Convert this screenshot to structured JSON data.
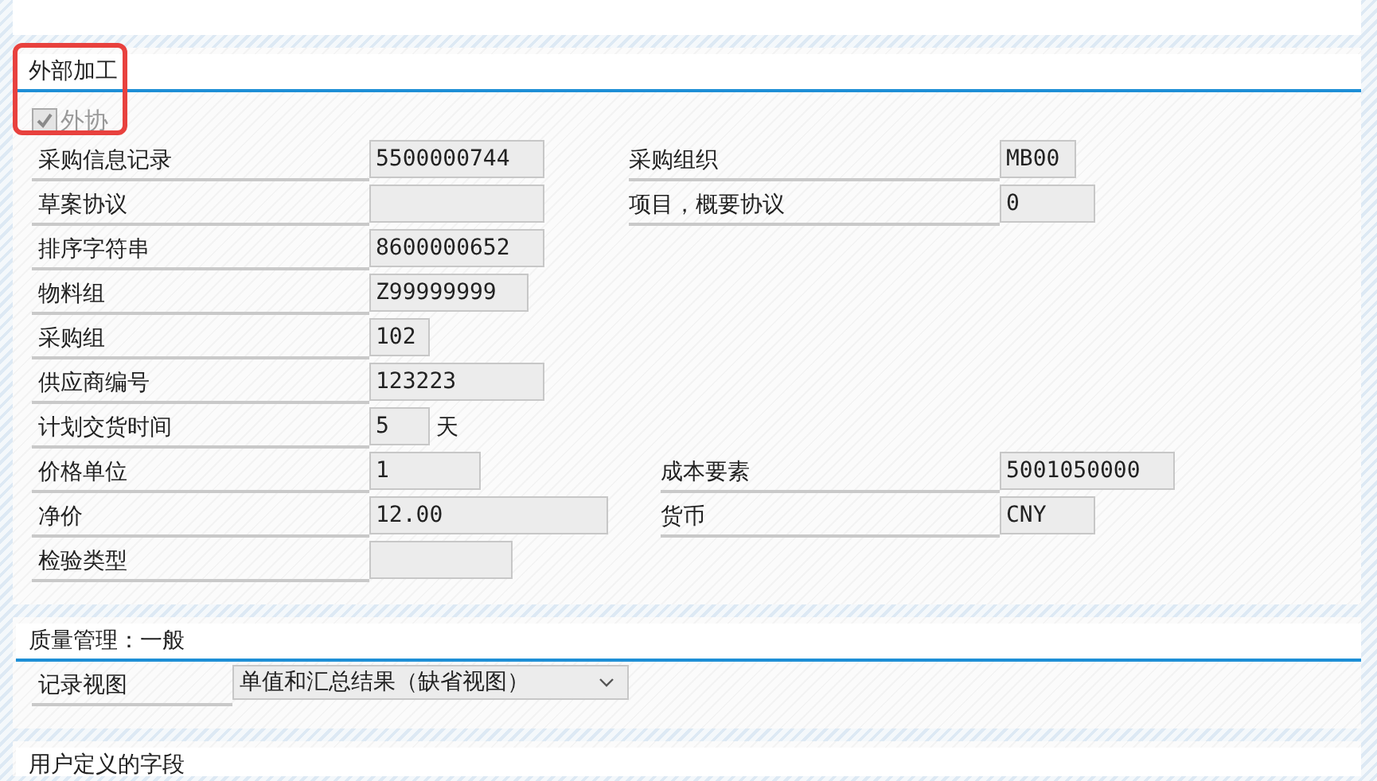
{
  "sections": [
    {
      "title": "外部加工",
      "checkbox": {
        "label": "外协",
        "checked": true,
        "disabled": true
      },
      "highlighted": true,
      "rows": [
        {
          "left": {
            "label": "采购信息记录",
            "value": "5500000744"
          },
          "right": {
            "label": "采购组织",
            "value": "MB00"
          }
        },
        {
          "left": {
            "label": "草案协议"
          },
          "right": {
            "label": "项目，概要协议",
            "value": "0"
          }
        },
        {
          "left": {
            "label": "排序字符串",
            "value": "8600000652"
          }
        },
        {
          "left": {
            "label": "物料组",
            "value": "Z99999999"
          }
        },
        {
          "left": {
            "label": "采购组",
            "value": "102"
          }
        },
        {
          "left": {
            "label": "供应商编号",
            "value": "123223"
          }
        },
        {
          "left": {
            "label": "计划交货时间",
            "value": "5",
            "unit": "天"
          }
        },
        {
          "left": {
            "label": "价格单位",
            "value": "1"
          },
          "right": {
            "label": "成本要素",
            "value": "5001050000"
          }
        },
        {
          "left": {
            "label": "净价",
            "value": "12.00"
          },
          "right": {
            "label": "货币",
            "value": "CNY"
          }
        },
        {
          "left": {
            "label": "检验类型"
          }
        }
      ]
    },
    {
      "title": "质量管理：一般",
      "highlighted": false,
      "rows": [
        {
          "left": {
            "label": "记录视图",
            "value": "单值和汇总结果（缺省视图）",
            "kind": "dropdown"
          }
        }
      ]
    },
    {
      "title": "用户定义的字段",
      "highlighted": false
    }
  ]
}
